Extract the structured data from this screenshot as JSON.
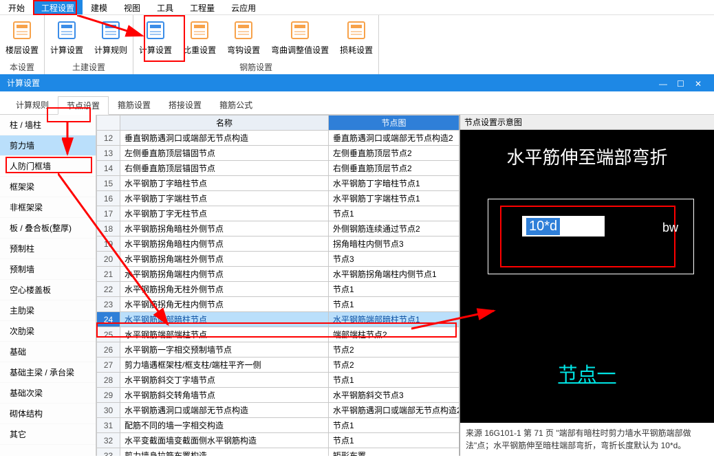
{
  "menubar": [
    "开始",
    "工程设置",
    "建模",
    "视图",
    "工具",
    "工程量",
    "云应用"
  ],
  "menu_active": 1,
  "ribbon": {
    "groups": [
      {
        "title": "本设置",
        "buttons": [
          {
            "label": "楼层设置"
          }
        ]
      },
      {
        "title": "土建设置",
        "buttons": [
          {
            "label": "计算设置"
          },
          {
            "label": "计算规则"
          }
        ]
      },
      {
        "title": "钢筋设置",
        "buttons": [
          {
            "label": "计算设置"
          },
          {
            "label": "比重设置"
          },
          {
            "label": "弯钩设置"
          },
          {
            "label": "弯曲调整值设置"
          },
          {
            "label": "损耗设置"
          }
        ]
      }
    ]
  },
  "panel_title": "计算设置",
  "tabs": [
    "计算规则",
    "节点设置",
    "箍筋设置",
    "搭接设置",
    "箍筋公式"
  ],
  "tab_active": 1,
  "sidebar": [
    "柱 / 墙柱",
    "剪力墙",
    "人防门框墙",
    "框架梁",
    "非框架梁",
    "板 / 叠合板(整厚)",
    "预制柱",
    "预制墙",
    "空心楼盖板",
    "主肋梁",
    "次肋梁",
    "基础",
    "基础主梁 / 承台梁",
    "基础次梁",
    "砌体结构",
    "其它"
  ],
  "side_sel": 1,
  "cols": {
    "num": "",
    "name": "名称",
    "node": "节点图"
  },
  "rows": [
    {
      "n": 12,
      "name": "垂直钢筋遇洞口或端部无节点构造",
      "node": "垂直筋遇洞口或端部无节点构造2"
    },
    {
      "n": 13,
      "name": "左侧垂直筋顶层锚固节点",
      "node": "左侧垂直筋顶层节点2"
    },
    {
      "n": 14,
      "name": "右侧垂直筋顶层锚固节点",
      "node": "右侧垂直筋顶层节点2"
    },
    {
      "n": 15,
      "name": "水平钢筋丁字暗柱节点",
      "node": "水平钢筋丁字暗柱节点1"
    },
    {
      "n": 16,
      "name": "水平钢筋丁字端柱节点",
      "node": "水平钢筋丁字端柱节点1"
    },
    {
      "n": 17,
      "name": "水平钢筋丁字无柱节点",
      "node": "节点1"
    },
    {
      "n": 18,
      "name": "水平钢筋拐角暗柱外侧节点",
      "node": "外侧钢筋连续通过节点2"
    },
    {
      "n": 19,
      "name": "水平钢筋拐角暗柱内侧节点",
      "node": "拐角暗柱内侧节点3"
    },
    {
      "n": 20,
      "name": "水平钢筋拐角端柱外侧节点",
      "node": "节点3"
    },
    {
      "n": 21,
      "name": "水平钢筋拐角端柱内侧节点",
      "node": "水平钢筋拐角端柱内侧节点1"
    },
    {
      "n": 22,
      "name": "水平钢筋拐角无柱外侧节点",
      "node": "节点1"
    },
    {
      "n": 23,
      "name": "水平钢筋拐角无柱内侧节点",
      "node": "节点1"
    },
    {
      "n": 24,
      "name": "水平钢筋端部暗柱节点",
      "node": "水平钢筋端部暗柱节点1"
    },
    {
      "n": 25,
      "name": "水平钢筋端部端柱节点",
      "node": "端部端柱节点2"
    },
    {
      "n": 26,
      "name": "水平钢筋一字相交预制墙节点",
      "node": "节点2"
    },
    {
      "n": 27,
      "name": "剪力墙遇框架柱/框支柱/端柱平齐一侧",
      "node": "节点2"
    },
    {
      "n": 28,
      "name": "水平钢筋斜交丁字墙节点",
      "node": "节点1"
    },
    {
      "n": 29,
      "name": "水平钢筋斜交转角墙节点",
      "node": "水平钢筋斜交节点3"
    },
    {
      "n": 30,
      "name": "水平钢筋遇洞口或端部无节点构造",
      "node": "水平钢筋遇洞口或端部无节点构造2"
    },
    {
      "n": 31,
      "name": "配筋不同的墙一字相交构造",
      "node": "节点1"
    },
    {
      "n": 32,
      "name": "水平变截面墙变截面侧水平钢筋构造",
      "node": "节点1"
    },
    {
      "n": 33,
      "name": "剪力墙身拉筋布置构造",
      "node": "矩形布置"
    }
  ],
  "row_sel": 24,
  "preview": {
    "title": "节点设置示意图",
    "heading": "水平筋伸至端部弯折",
    "value": "10*d",
    "bw": "bw",
    "node": "节点一",
    "source": "来源 16G101-1 第 71 页 \"端部有暗柱时剪力墙水平钢筋端部做法\"点；水平钢筋伸至暗柱端部弯折，弯折长度默认为 10*d。"
  }
}
